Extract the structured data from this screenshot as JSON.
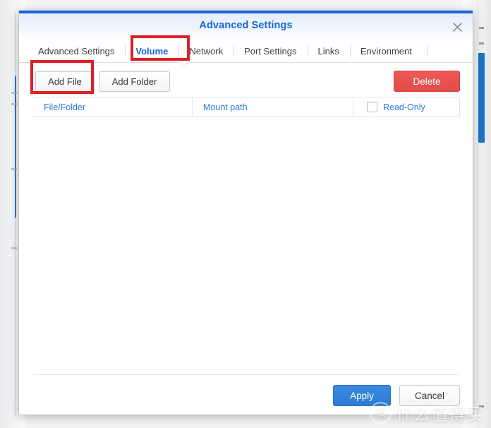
{
  "dialog": {
    "title": "Advanced Settings",
    "close_icon": "close-icon"
  },
  "tabs": [
    {
      "label": "Advanced Settings",
      "active": false
    },
    {
      "label": "Volume",
      "active": true
    },
    {
      "label": "Network",
      "active": false
    },
    {
      "label": "Port Settings",
      "active": false
    },
    {
      "label": "Links",
      "active": false
    },
    {
      "label": "Environment",
      "active": false
    }
  ],
  "toolbar": {
    "add_file_label": "Add File",
    "add_folder_label": "Add Folder",
    "delete_label": "Delete"
  },
  "table": {
    "columns": [
      {
        "label": "File/Folder"
      },
      {
        "label": "Mount path"
      },
      {
        "label": "Read-Only",
        "has_checkbox": true,
        "checked": false
      }
    ],
    "rows": []
  },
  "footer": {
    "apply_label": "Apply",
    "cancel_label": "Cancel"
  },
  "annotations": [
    {
      "target": "Volume tab",
      "color": "#dd1f26"
    },
    {
      "target": "Add File button",
      "color": "#dd1f26"
    }
  ],
  "watermark": {
    "badge": "值",
    "text": "什么值得买"
  },
  "colors": {
    "accent_blue": "#1565d8",
    "danger_red": "#e24b48",
    "apply_blue": "#2b7ad6",
    "annotation_red": "#dd1f26",
    "header_link_blue": "#2d78e0"
  }
}
